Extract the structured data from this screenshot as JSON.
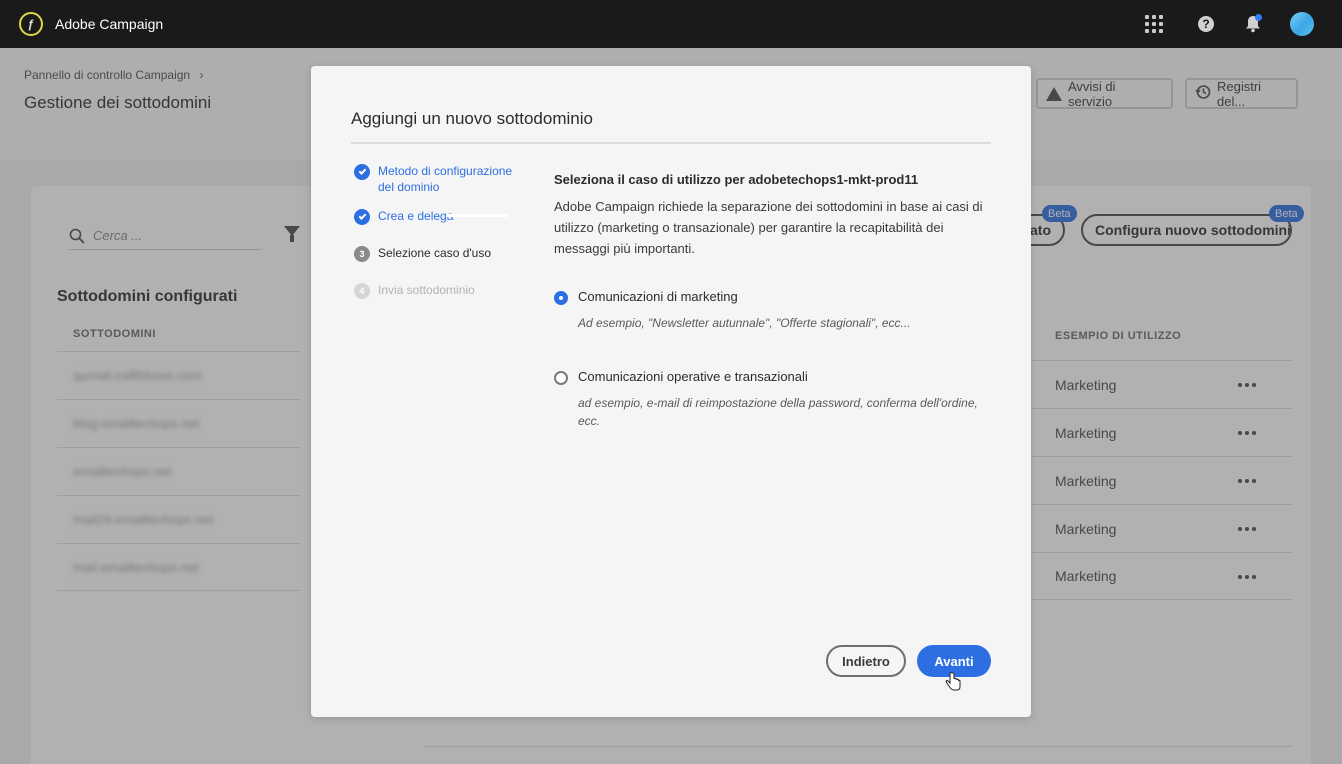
{
  "app": {
    "title": "Adobe Campaign",
    "logo_icon": "adobe-campaign-logo"
  },
  "topbar": {
    "icons": [
      "apps-grid-icon",
      "help-icon",
      "notification-bell-icon",
      "avatar"
    ],
    "help_glyph": "?"
  },
  "header": {
    "breadcrumb": "Pannello di controllo Campaign",
    "breadcrumb_separator": "›",
    "page_title": "Gestione dei sottodomini",
    "service_alerts_label": "Avvisi di servizio",
    "logs_label": "Registri del..."
  },
  "card": {
    "search_placeholder": "Cerca ...",
    "section_title": "Sottodomini configurati",
    "col_subdomains": "SOTTODOMINI",
    "col_use_case": "ESEMPIO DI UTILIZZO",
    "delegate_button_partial": "ato",
    "configure_button": "Configura nuovo sottodominio",
    "beta_label": "Beta",
    "rows": [
      {
        "subdomain": "qumail.callthbove.com",
        "use_case": "Marketing"
      },
      {
        "subdomain": "blog.emailtechops.net",
        "use_case": "Marketing"
      },
      {
        "subdomain": "emailtechops.net",
        "use_case": "Marketing"
      },
      {
        "subdomain": "mail24.emailtechops.net",
        "use_case": "Marketing"
      },
      {
        "subdomain": "mail.emailtechops.net",
        "use_case": "Marketing"
      }
    ]
  },
  "modal": {
    "title": "Aggiungi un nuovo sottodominio",
    "steps": [
      {
        "num": "1",
        "label": "Metodo di configurazione del dominio",
        "state": "done"
      },
      {
        "num": "2",
        "label": "Crea e delega",
        "state": "done"
      },
      {
        "num": "3",
        "label": "Selezione caso d'uso",
        "state": "current"
      },
      {
        "num": "4",
        "label": "Invia sottodominio",
        "state": "todo"
      }
    ],
    "content_title": "Seleziona il caso di utilizzo per adobetechops1-mkt-prod11",
    "content_desc": "Adobe Campaign richiede la separazione dei sottodomini in base ai casi di utilizzo (marketing o  transazionale) per garantire la recapitabilità dei messaggi più importanti.",
    "options": [
      {
        "label": "Comunicazioni di marketing",
        "hint": "Ad esempio, \"Newsletter autunnale\", \"Offerte stagionali\", ecc...",
        "selected": true
      },
      {
        "label": "Comunicazioni operative e transazionali",
        "hint": "ad esempio, e-mail di reimpostazione della password, conferma dell'ordine, ecc.",
        "selected": false
      }
    ],
    "back_label": "Indietro",
    "next_label": "Avanti"
  },
  "colors": {
    "accent": "#2d6fe3",
    "topbar": "#1a1a1a",
    "modal_bg": "#f5f5f5"
  }
}
